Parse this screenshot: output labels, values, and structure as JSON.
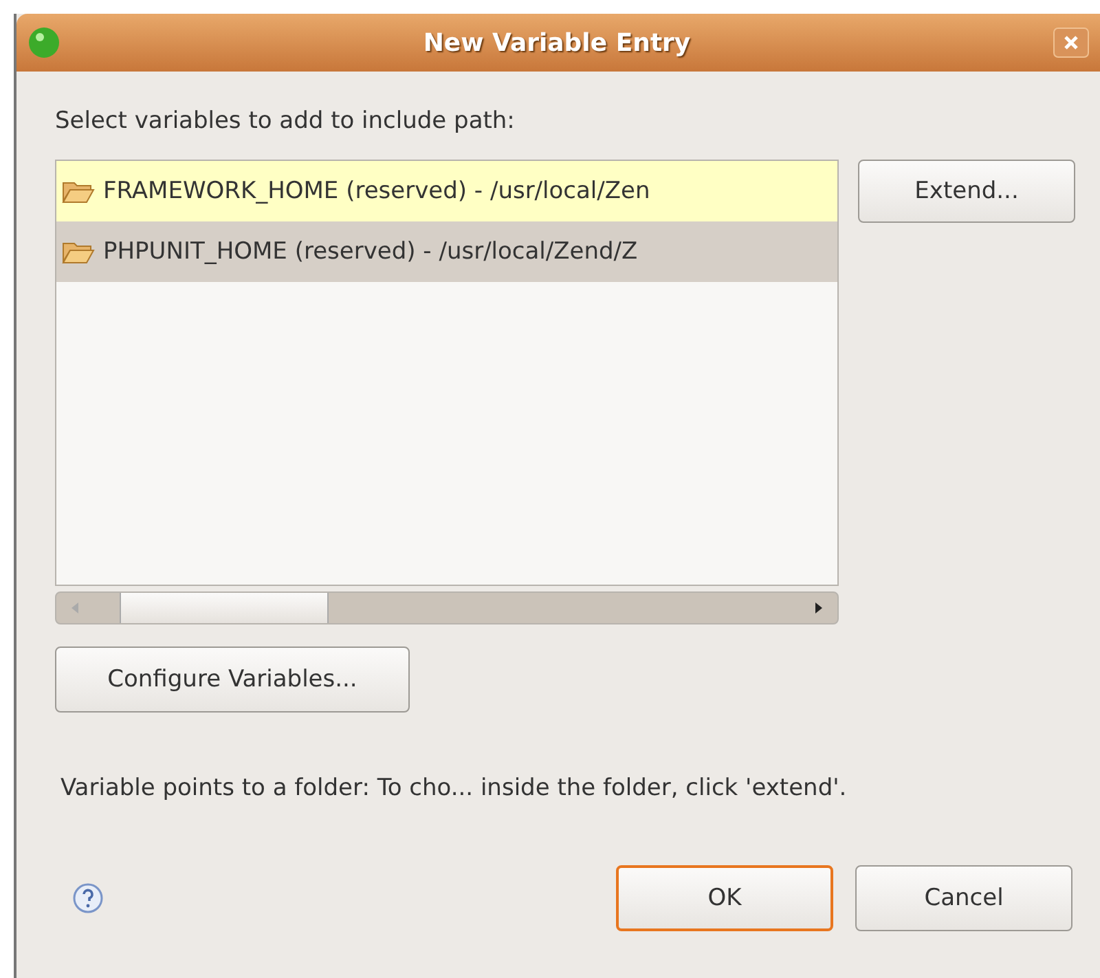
{
  "window": {
    "title": "New Variable Entry"
  },
  "prompt": "Select variables to add to include path:",
  "variables": [
    {
      "label": "FRAMEWORK_HOME (reserved) - /usr/local/Zen",
      "selected": false,
      "hovered": true
    },
    {
      "label": "PHPUNIT_HOME (reserved) - /usr/local/Zend/Z",
      "selected": true,
      "hovered": false
    }
  ],
  "extend_button": "Extend...",
  "configure_button": "Configure Variables...",
  "info": "Variable points to a folder: To cho... inside the folder, click 'extend'.",
  "buttons": [
    {
      "label": "OK",
      "default": true
    },
    {
      "label": "Cancel",
      "default": false
    }
  ]
}
